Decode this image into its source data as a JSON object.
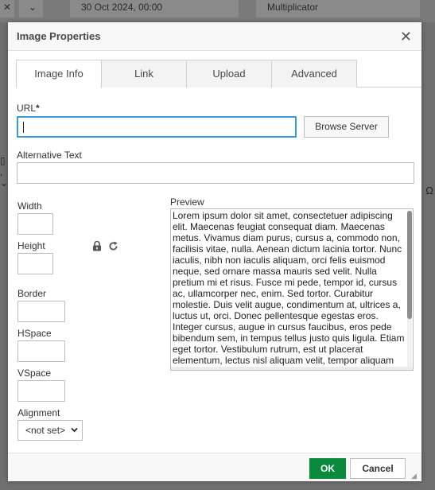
{
  "background": {
    "close_glyph": "✕",
    "chevron_glyph": "⌄",
    "date_value": "30 Oct 2024, 00:00",
    "multiplicator_value": "Multiplicator",
    "omega_glyph": "Ω"
  },
  "dialog": {
    "title": "Image Properties",
    "close_glyph": "✕"
  },
  "tabs": [
    {
      "label": "Image Info"
    },
    {
      "label": "Link"
    },
    {
      "label": "Upload"
    },
    {
      "label": "Advanced"
    }
  ],
  "fields": {
    "url_label": "URL",
    "url_required": "*",
    "url_value": "",
    "browse_button": "Browse Server",
    "alt_label": "Alternative Text",
    "alt_value": "",
    "width_label": "Width",
    "width_value": "",
    "height_label": "Height",
    "height_value": "",
    "border_label": "Border",
    "border_value": "",
    "hspace_label": "HSpace",
    "hspace_value": "",
    "vspace_label": "VSpace",
    "vspace_value": "",
    "alignment_label": "Alignment",
    "alignment_selected": "<not set>"
  },
  "icons": {
    "lock": "lock-icon",
    "reset": "reset-icon",
    "lock_glyph": "🔒",
    "reset_glyph": "↻"
  },
  "preview": {
    "label": "Preview",
    "text": "Lorem ipsum dolor sit amet, consectetuer adipiscing elit. Maecenas feugiat consequat diam. Maecenas metus. Vivamus diam purus, cursus a, commodo non, facilisis vitae, nulla. Aenean dictum lacinia tortor. Nunc iaculis, nibh non iaculis aliquam, orci felis euismod neque, sed ornare massa mauris sed velit. Nulla pretium mi et risus. Fusce mi pede, tempor id, cursus ac, ullamcorper nec, enim. Sed tortor. Curabitur molestie. Duis velit augue, condimentum at, ultrices a, luctus ut, orci. Donec pellentesque egestas eros. Integer cursus, augue in cursus faucibus, eros pede bibendum sem, in tempus tellus justo quis ligula. Etiam eget tortor. Vestibulum rutrum, est ut placerat elementum, lectus nisl aliquam velit, tempor aliquam"
  },
  "footer": {
    "ok": "OK",
    "cancel": "Cancel"
  },
  "colors": {
    "ok_button": "#0a8a3c",
    "focus_border": "#3b9ad9",
    "overlay": "#6f6f6f"
  }
}
